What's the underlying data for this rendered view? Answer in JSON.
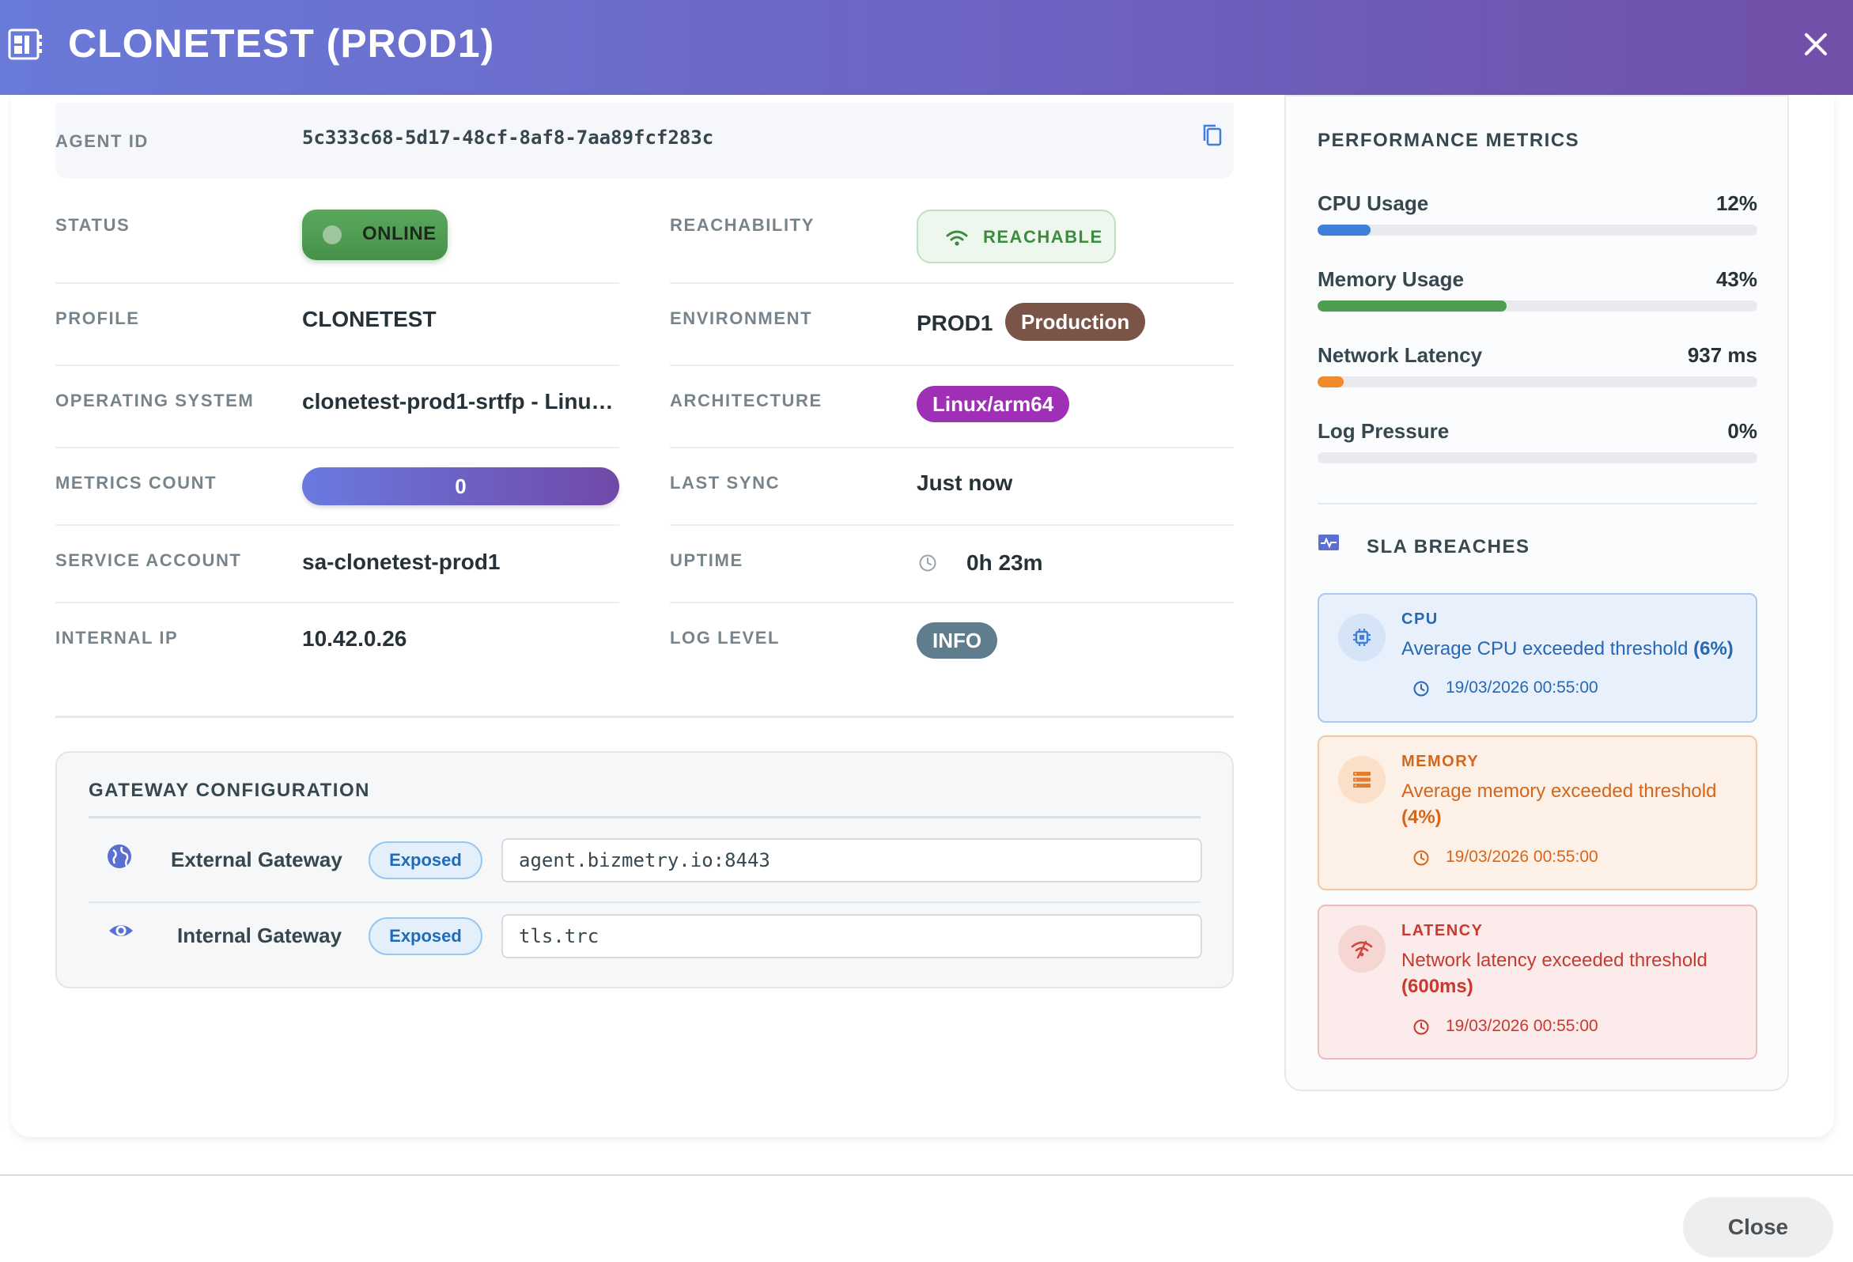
{
  "header": {
    "title": "CLONETEST (PROD1)",
    "icon": "dashboard-icon",
    "close_icon": "close-icon"
  },
  "agent": {
    "agent_id_label": "AGENT ID",
    "agent_id_value": "5c333c68-5d17-48cf-8af8-7aa89fcf283c",
    "copy_icon": "copy-icon"
  },
  "fields": {
    "status": {
      "label": "STATUS",
      "value": "ONLINE"
    },
    "reachability": {
      "label": "REACHABILITY",
      "value": "REACHABLE"
    },
    "profile": {
      "label": "PROFILE",
      "value": "CLONETEST"
    },
    "environment": {
      "label": "ENVIRONMENT",
      "value": "PROD1",
      "badge": "Production"
    },
    "operating_system": {
      "label": "OPERATING SYSTEM",
      "value": "clonetest-prod1-srtfp - Linu…"
    },
    "architecture": {
      "label": "ARCHITECTURE",
      "value": "Linux/arm64"
    },
    "metrics_count": {
      "label": "METRICS COUNT",
      "value": "0"
    },
    "last_sync": {
      "label": "LAST SYNC",
      "value": "Just now"
    },
    "service_account": {
      "label": "SERVICE ACCOUNT",
      "value": "sa-clonetest-prod1"
    },
    "uptime": {
      "label": "UPTIME",
      "value": "0h 23m"
    },
    "internal_ip": {
      "label": "INTERNAL IP",
      "value": "10.42.0.26"
    },
    "log_level": {
      "label": "LOG LEVEL",
      "value": "INFO"
    }
  },
  "gateway": {
    "title": "GATEWAY CONFIGURATION",
    "rows": [
      {
        "name": "External Gateway",
        "status": "Exposed",
        "value": "agent.bizmetry.io:8443",
        "icon": "globe-icon"
      },
      {
        "name": "Internal Gateway",
        "status": "Exposed",
        "value": "tls.trc",
        "icon": "eye-icon"
      }
    ]
  },
  "performance": {
    "title": "PERFORMANCE METRICS",
    "metrics": [
      {
        "name": "CPU Usage",
        "value": "12%",
        "fraction": 0.12,
        "color": "#3f7fd9"
      },
      {
        "name": "Memory Usage",
        "value": "43%",
        "fraction": 0.43,
        "color": "#4c9f50"
      },
      {
        "name": "Network Latency",
        "value": "937 ms",
        "fraction": 0.06,
        "color": "#f08a2c"
      },
      {
        "name": "Log Pressure",
        "value": "0%",
        "fraction": 0.0,
        "color": "#9e9e9e"
      }
    ]
  },
  "sla": {
    "title": "SLA BREACHES",
    "breaches": [
      {
        "type": "CPU",
        "message": "Average CPU exceeded threshold",
        "threshold": "(6%)",
        "time": "19/03/2026 00:55:00",
        "icon": "chip-icon",
        "colors": {
          "bg": "#e8f1fb",
          "border": "#a9caee",
          "text": "#2767b3",
          "iconbg": "#d5e4f6"
        }
      },
      {
        "type": "MEMORY",
        "message": "Average memory exceeded threshold",
        "threshold": "(4%)",
        "time": "19/03/2026 00:55:00",
        "icon": "memory-icon",
        "colors": {
          "bg": "#fdf1e7",
          "border": "#f4c9a2",
          "text": "#d4661b",
          "iconbg": "#fae0c8"
        }
      },
      {
        "type": "LATENCY",
        "message": "Network latency exceeded threshold",
        "threshold": "(600ms)",
        "time": "19/03/2026 00:55:00",
        "icon": "wifi-off-icon",
        "colors": {
          "bg": "#fbebea",
          "border": "#efbcb8",
          "text": "#c8392f",
          "iconbg": "#f6d6d3"
        }
      }
    ]
  },
  "footer": {
    "close_label": "Close"
  }
}
